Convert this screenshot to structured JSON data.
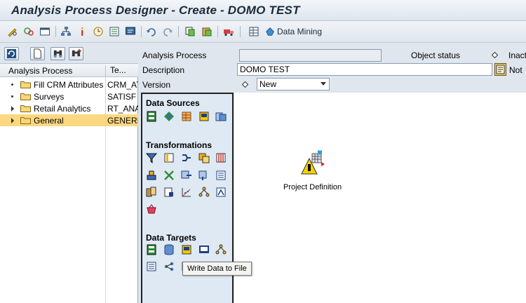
{
  "window": {
    "title": "Analysis Process Designer - Create - DOMO TEST"
  },
  "toolbar": {
    "icons": [
      "pencil-glasses-icon",
      "display-change-icon",
      "window-icon",
      "hierarchy-icon",
      "info-icon",
      "clock-icon",
      "list-icon",
      "monitor-icon",
      "undo-icon",
      "redo-icon",
      "copy-icon",
      "paste-icon",
      "truck-icon",
      "table-icon",
      "data-mining-icon"
    ],
    "data_mining_label": "Data Mining"
  },
  "tree": {
    "col_process": "Analysis Process",
    "col_tech": "Te...",
    "items": [
      {
        "name": "Fill CRM Attributes",
        "tech": "CRM_AT",
        "expandable": false,
        "selected": false
      },
      {
        "name": "Surveys",
        "tech": "SATISF",
        "expandable": false,
        "selected": false
      },
      {
        "name": "Retail Analytics",
        "tech": "RT_ANA",
        "expandable": true,
        "selected": false
      },
      {
        "name": "General",
        "tech": "GENERI",
        "expandable": true,
        "selected": true
      }
    ]
  },
  "form": {
    "analysis_process_label": "Analysis Process",
    "analysis_process_value": "",
    "object_status_label": "Object status",
    "object_status_value": "Inact",
    "description_label": "Description",
    "description_value": "DOMO TEST",
    "not_label": "Not",
    "version_label": "Version",
    "version_value": "New"
  },
  "palette": {
    "data_sources": "Data Sources",
    "transformations": "Transformations",
    "data_targets": "Data Targets"
  },
  "canvas": {
    "node_label": "Project Definition"
  },
  "tooltip": "Write Data to File",
  "colors": {
    "selected_row": "#fcd881",
    "palette_bg": "#dfe9f3",
    "frame_bg": "#dfe6ed"
  }
}
